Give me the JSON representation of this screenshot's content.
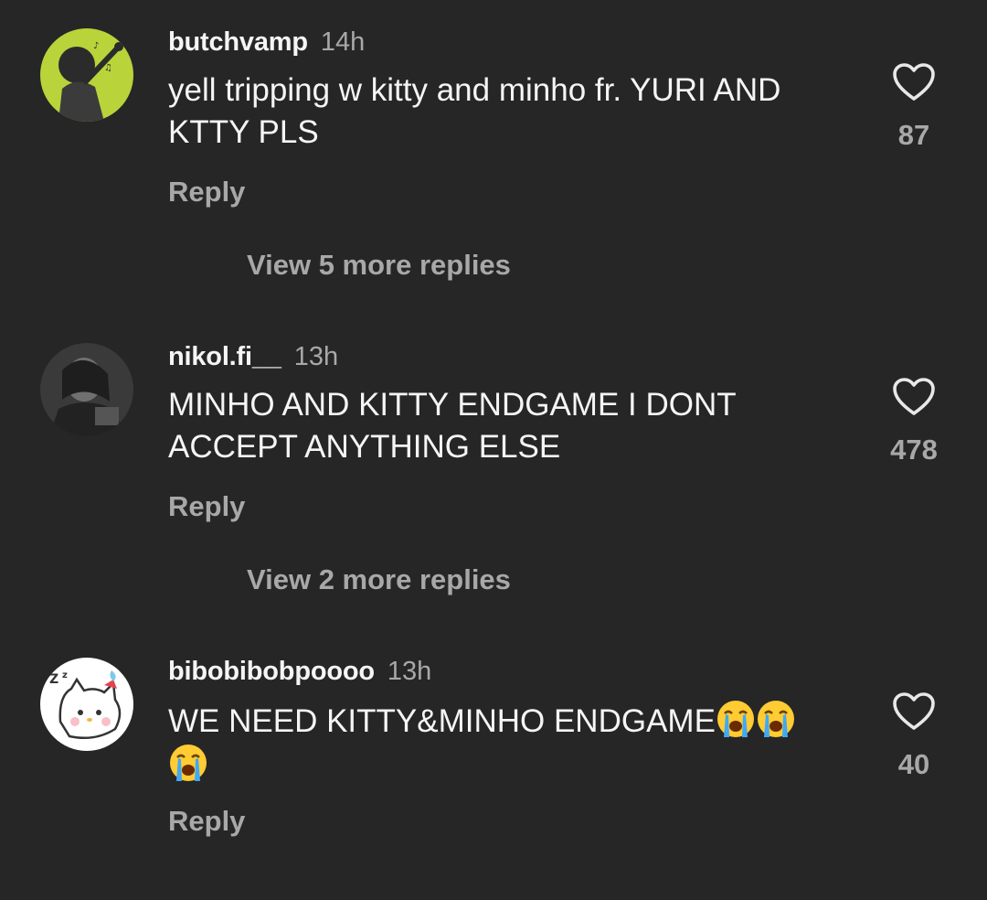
{
  "comments": [
    {
      "username": "butchvamp",
      "time": "14h",
      "text": "yell tripping w kitty and minho fr. YURI AND KTTY PLS",
      "reply_label": "Reply",
      "view_more": "View 5 more replies",
      "likes": "87",
      "avatar_icon": "illustrated-avatar-icon"
    },
    {
      "username": "nikol.fi__",
      "time": "13h",
      "text": "MINHO AND KITTY ENDGAME I DONT ACCEPT ANYTHING ELSE",
      "reply_label": "Reply",
      "view_more": "View 2 more replies",
      "likes": "478",
      "avatar_icon": "photo-avatar-icon"
    },
    {
      "username": "bibobibobpoooo",
      "time": "13h",
      "text": "WE NEED KITTY&MINHO ENDGAME",
      "emojis": [
        "😭",
        "😭",
        "😭"
      ],
      "reply_label": "Reply",
      "likes": "40",
      "avatar_icon": "cat-avatar-icon"
    }
  ],
  "colors": {
    "background": "#262626",
    "primary_text": "#f5f5f5",
    "secondary_text": "#a8a8a8"
  }
}
